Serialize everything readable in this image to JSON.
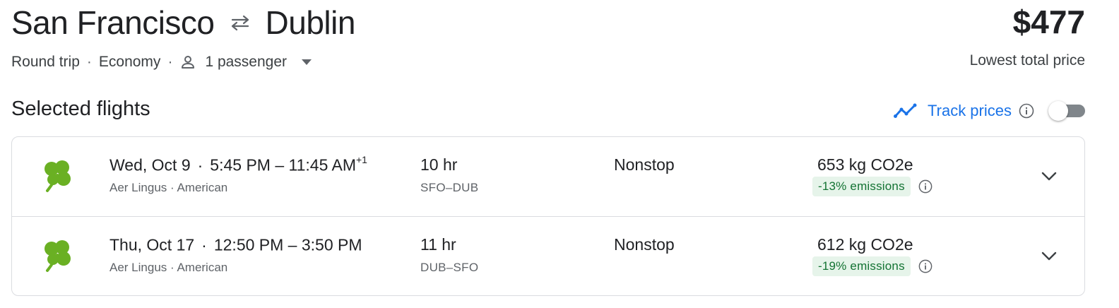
{
  "route": {
    "origin": "San Francisco",
    "destination": "Dublin",
    "swap_icon": "swap-arrows-icon"
  },
  "price": {
    "amount": "$477",
    "note": "Lowest total price"
  },
  "meta": {
    "trip_type": "Round trip",
    "cabin": "Economy",
    "passengers": "1 passenger",
    "separator": "·"
  },
  "section": {
    "title": "Selected flights"
  },
  "track": {
    "label": "Track prices",
    "enabled": false
  },
  "flights": [
    {
      "date": "Wed, Oct 9",
      "time_range": "5:45 PM – 11:45 AM",
      "day_offset": "+1",
      "airlines": "Aer Lingus · American",
      "duration": "10 hr",
      "airports": "SFO–DUB",
      "stops": "Nonstop",
      "emissions": "653 kg CO2e",
      "emissions_delta": "-13% emissions"
    },
    {
      "date": "Thu, Oct 17",
      "time_range": "12:50 PM – 3:50 PM",
      "day_offset": "",
      "airlines": "Aer Lingus · American",
      "duration": "11 hr",
      "airports": "DUB–SFO",
      "stops": "Nonstop",
      "emissions": "612 kg CO2e",
      "emissions_delta": "-19% emissions"
    }
  ],
  "colors": {
    "accent": "#1a73e8",
    "shamrock": "#6ab023",
    "emissions_bg": "#e6f4ea",
    "emissions_text": "#137333"
  }
}
